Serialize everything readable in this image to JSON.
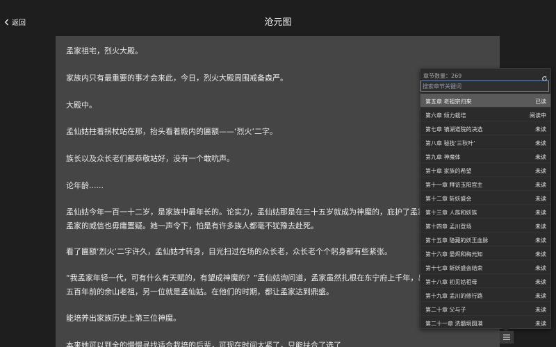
{
  "header": {
    "back_label": "返回",
    "title": "沧元图"
  },
  "content": {
    "paragraphs": [
      "孟家祖宅，烈火大殿。",
      "家族内只有最重要的事才会来此，今日，烈火大殿周围戒备森严。",
      "大殿中。",
      "孟仙姑拄着拐杖站在那，抬头看着殿内的匾额——‘烈火’二字。",
      "族长以及众长老们都恭敬站好，没有一个敢吭声。",
      "论年龄......",
      "孟仙姑今年一百一十二岁，是家族中最年长的。论实力，孟仙姑那是在三十五岁就成为神魔的，庇护了孟家也兴盛了八十年，在孟家的威信也毋庸置疑。她一声令下，怕是有许多族人都毫不犹豫去赴死。",
      "看了匾额‘烈火’二字许久，孟仙姑才转身，目光扫过在场的众长老，众长老个个躬身都有些紧张。",
      "“我孟家年轻一代，可有什么有天赋的，有望成神魔的？”孟仙姑询问道，孟家虽然扎根在东宁府上千年，出过两位神魔，一位是五百年前的余山老祖，另一位就是孟仙姑。在他们的时期，都让孟家达到鼎盛。",
      "能培养出家族历史上第三位神魔。",
      "本来她可以到全的慢慢寻找适合栽培的后辈，可现在时间太紧了，只能扶合了选了"
    ]
  },
  "chapter_panel": {
    "count_label": "章节数量：269",
    "search_placeholder": "搜索章节关键词",
    "chapters": [
      {
        "name": "第五章 老祖宗归来",
        "status": "已读"
      },
      {
        "name": "第六章 倾力栽培",
        "status": "阅读中"
      },
      {
        "name": "第七章 镇湖道院的决选",
        "status": "未读"
      },
      {
        "name": "第八章 秘技‘三秋叶’",
        "status": "未读"
      },
      {
        "name": "第九章 神魔体",
        "status": "未读"
      },
      {
        "name": "第十章 家族的希望",
        "status": "未读"
      },
      {
        "name": "第十一章 拜访玉阳宫主",
        "status": "未读"
      },
      {
        "name": "第十二章 斩妖盛会",
        "status": "未读"
      },
      {
        "name": "第十三章 人族和妖族",
        "status": "未读"
      },
      {
        "name": "第十四章 孟川登场",
        "status": "未读"
      },
      {
        "name": "第十五章 隐藏的妖王血脉",
        "status": "未读"
      },
      {
        "name": "第十六章 晏烬和梅元知",
        "status": "未读"
      },
      {
        "name": "第十七章 斩妖盛会结束",
        "status": "未读"
      },
      {
        "name": "第十八章 初见姑祖母",
        "status": "未读"
      },
      {
        "name": "第十九章 孟川的修行路",
        "status": "未读"
      },
      {
        "name": "第二十章 父与子",
        "status": "未读"
      },
      {
        "name": "第二十一章 洗髓境圆满",
        "status": "未读"
      }
    ]
  },
  "icons": {
    "back": "chevron-left-icon",
    "refresh": "refresh-icon",
    "menu": "list-icon"
  },
  "colors": {
    "background": "#1e1e1e",
    "content_bg": "#454545",
    "panel_bg": "#2b2b2b",
    "active_row": "#5a5a5a",
    "search_border": "#6d8fb8"
  }
}
